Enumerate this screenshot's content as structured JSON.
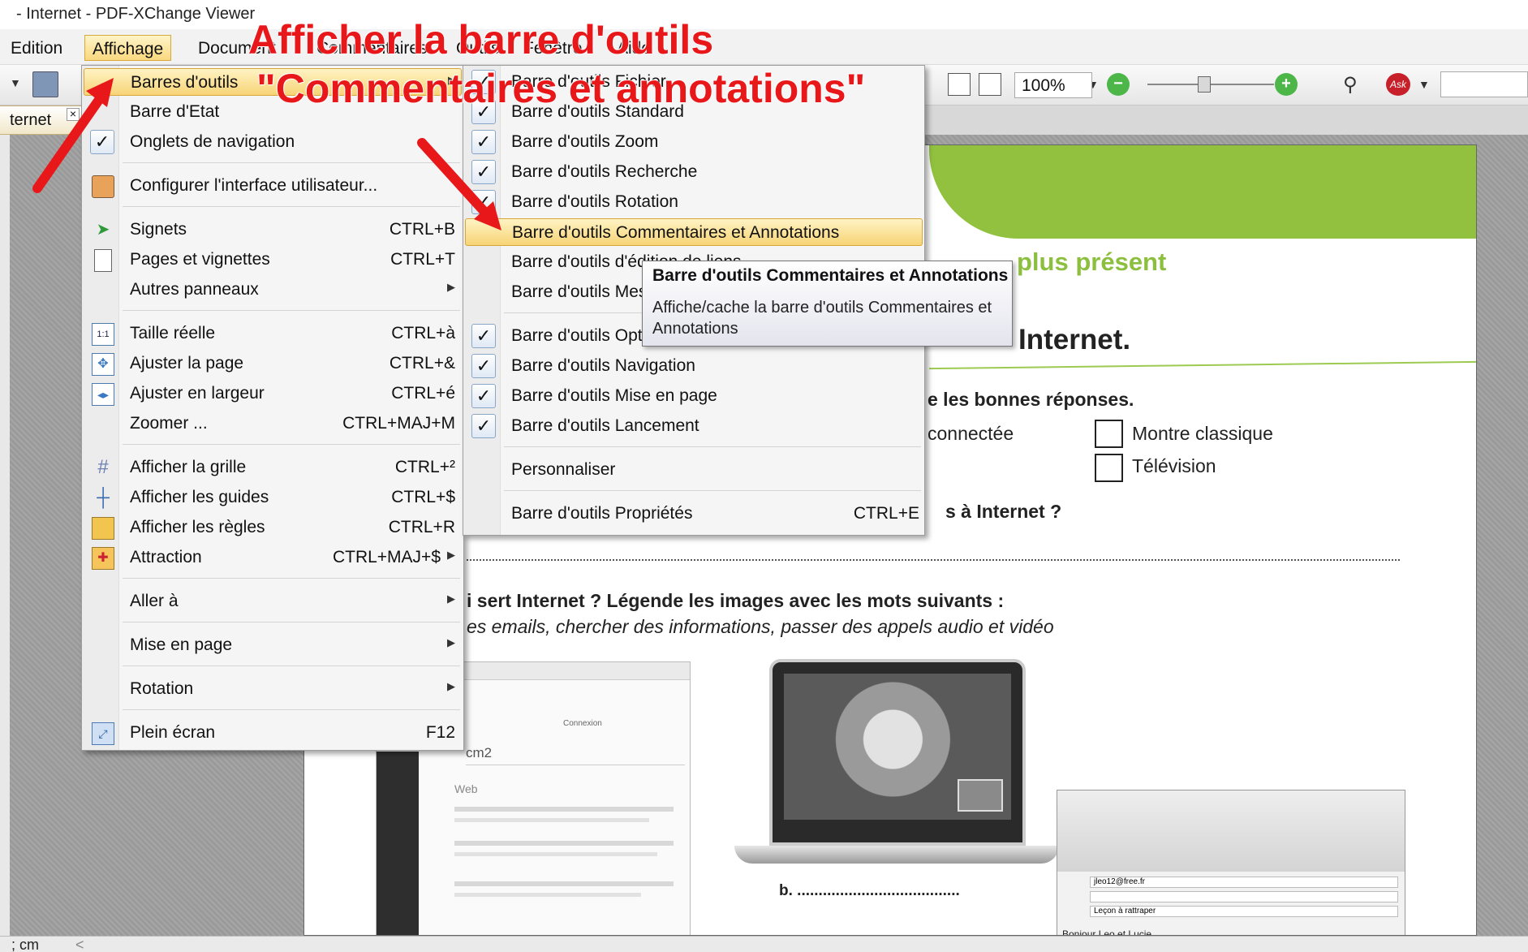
{
  "window": {
    "title": "- Internet - PDF-XChange Viewer"
  },
  "menubar": {
    "items": [
      "Edition",
      "Affichage",
      "Document",
      "Commentaires",
      "Outils",
      "Fenêtre",
      "Aide"
    ]
  },
  "toolbar": {
    "zoom_value": "100%"
  },
  "tab": {
    "label": "ternet",
    "close": "×"
  },
  "status": {
    "text": "; cm"
  },
  "annotation": {
    "line1": "Afficher la barre d'outils",
    "line2": "\"Commentaires et annotations\""
  },
  "menu_affichage": {
    "items": [
      {
        "label": "Barres d'outils",
        "shortcut": "",
        "submenu": true,
        "highlight": true
      },
      {
        "label": "Barre d'Etat",
        "shortcut": ""
      },
      {
        "label": "Onglets de navigation",
        "shortcut": "",
        "checked": true
      },
      {
        "label": "Configurer l'interface utilisateur...",
        "shortcut": "",
        "icon": "configure-icon"
      },
      {
        "label": "Signets",
        "shortcut": "CTRL+B",
        "icon": "bookmark-icon"
      },
      {
        "label": "Pages et vignettes",
        "shortcut": "CTRL+T",
        "icon": "page-icon"
      },
      {
        "label": "Autres panneaux",
        "shortcut": "",
        "submenu": true
      },
      {
        "label": "Taille réelle",
        "shortcut": "CTRL+à",
        "icon": "actual-size-icon"
      },
      {
        "label": "Ajuster la page",
        "shortcut": "CTRL+&",
        "icon": "fit-page-icon"
      },
      {
        "label": "Ajuster en largeur",
        "shortcut": "CTRL+é",
        "icon": "fit-width-icon"
      },
      {
        "label": "Zoomer ...",
        "shortcut": "CTRL+MAJ+M"
      },
      {
        "label": "Afficher la grille",
        "shortcut": "CTRL+²",
        "icon": "grid-icon"
      },
      {
        "label": "Afficher  les guides",
        "shortcut": "CTRL+$",
        "icon": "guides-icon"
      },
      {
        "label": "Afficher les règles",
        "shortcut": "CTRL+R",
        "icon": "ruler-icon"
      },
      {
        "label": "Attraction",
        "shortcut": "CTRL+MAJ+$",
        "submenu": true,
        "icon": "snap-icon"
      },
      {
        "label": "Aller à",
        "shortcut": "",
        "submenu": true
      },
      {
        "label": "Mise en page",
        "shortcut": "",
        "submenu": true
      },
      {
        "label": "Rotation",
        "shortcut": "",
        "submenu": true
      },
      {
        "label": "Plein écran",
        "shortcut": "F12",
        "icon": "fullscreen-icon"
      }
    ]
  },
  "menu_barres": {
    "items": [
      {
        "label": "Barre d'outils Fichier",
        "checked": true
      },
      {
        "label": "Barre d'outils Standard",
        "checked": true
      },
      {
        "label": "Barre d'outils Zoom",
        "checked": true
      },
      {
        "label": "Barre d'outils Recherche",
        "checked": true
      },
      {
        "label": "Barre d'outils Rotation",
        "checked": true
      },
      {
        "label": "Barre d'outils Commentaires et Annotations",
        "checked": false,
        "highlight": true
      },
      {
        "label": "Barre d'outils d'édition de liens",
        "checked": false
      },
      {
        "label": "Barre d'outils Mesurage",
        "checked": false
      },
      {
        "label": "Barre d'outils Options",
        "checked": true
      },
      {
        "label": "Barre d'outils Navigation",
        "checked": true
      },
      {
        "label": "Barre d'outils Mise en page",
        "checked": true
      },
      {
        "label": "Barre d'outils Lancement",
        "checked": true
      },
      {
        "label": "Personnaliser",
        "checked": false
      },
      {
        "label": "Barre d'outils Propriétés",
        "checked": false,
        "shortcut": "CTRL+E"
      }
    ]
  },
  "tooltip": {
    "title": "Barre d'outils Commentaires et Annotations",
    "text": "Affiche/cache la barre d'outils Commentaires et Annotations"
  },
  "document": {
    "heading_partial": "plus présent",
    "title_partial": "Internet.",
    "question1_partial": "e les bonnes réponses.",
    "option_connected": "connectée",
    "option_classic": "Montre classique",
    "option_tv": "Télévision",
    "question2_partial": "s à Internet ?",
    "question3_partial": "i sert Internet ? Légende les images avec les mots suivants :",
    "words_partial": "es emails, chercher des informations, passer des appels audio et vidéo",
    "search_text": "cm2",
    "web_label": "Web",
    "browser_connect": "Connexion",
    "blank_b": "b. ......................................",
    "mail_greeting": "Bonjour Leo et Lucie,",
    "mail_subject": "Leçon à rattraper",
    "mail_to": "jleo12@free.fr"
  }
}
